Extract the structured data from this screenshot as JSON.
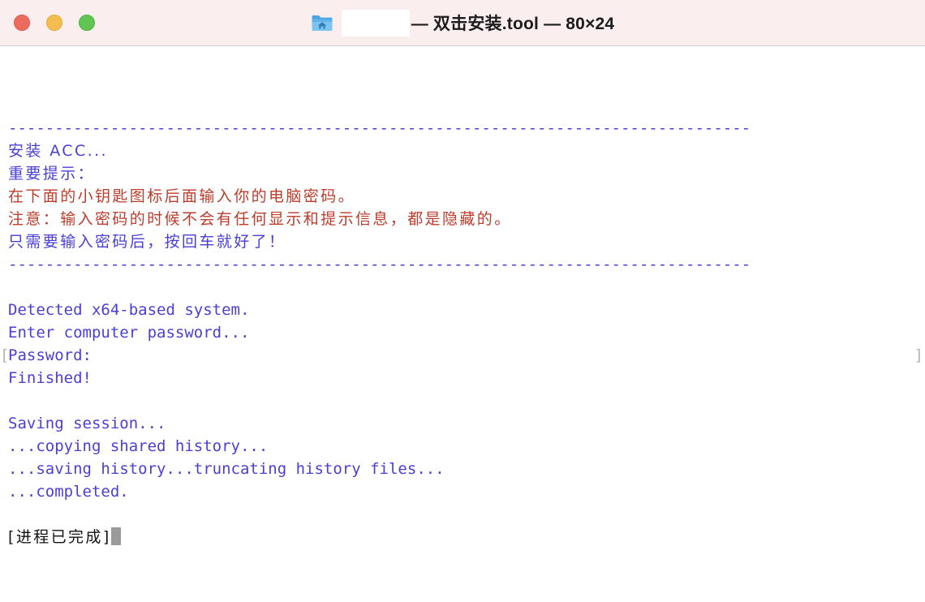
{
  "window": {
    "title_prefix_icon": "home-folder-icon",
    "redacted_label": "",
    "title_text": "— 双击安装.tool — 80×24",
    "size_label": "80×24",
    "traffic_lights": {
      "close_color": "#ED6A5E",
      "minimize_color": "#F4BD4F",
      "maximize_color": "#61C554"
    },
    "titlebar_bg": "#FAEEEE"
  },
  "colors": {
    "blue": "#4A3FD4",
    "red": "#BD3C2C",
    "black": "#111111",
    "gray_bracket": "#B3B3B3",
    "cursor": "#9A9A9A",
    "background": "#FFFFFF"
  },
  "terminal": {
    "separator_top": "--------------------------------------------------------------------------------",
    "separator_bottom": "--------------------------------------------------------------------------------",
    "lines": [
      {
        "text": "安装 ACC...",
        "color": "blue",
        "cjk": true
      },
      {
        "text": "重要提示：",
        "color": "blue",
        "cjk": true
      },
      {
        "text": "在下面的小钥匙图标后面输入你的电脑密码。",
        "color": "red",
        "cjk": true
      },
      {
        "text": "注意：输入密码的时候不会有任何显示和提示信息，都是隐藏的。",
        "color": "red",
        "cjk": true
      },
      {
        "text": "只需要输入密码后，按回车就好了！",
        "color": "blue",
        "cjk": true
      }
    ],
    "output_lines": [
      {
        "text": "Detected x64-based system.",
        "color": "blue"
      },
      {
        "text": "Enter computer password...",
        "color": "blue"
      },
      {
        "text": "Password:",
        "color": "blue"
      },
      {
        "text": "Finished!",
        "color": "blue"
      },
      {
        "text": "",
        "color": "blue"
      },
      {
        "text": "Saving session...",
        "color": "blue"
      },
      {
        "text": "...copying shared history...",
        "color": "blue"
      },
      {
        "text": "...saving history...truncating history files...",
        "color": "blue"
      },
      {
        "text": "...completed.",
        "color": "blue"
      }
    ],
    "password_marker_left": "[",
    "password_marker_right": "]",
    "process_completed": "[进程已完成]"
  }
}
